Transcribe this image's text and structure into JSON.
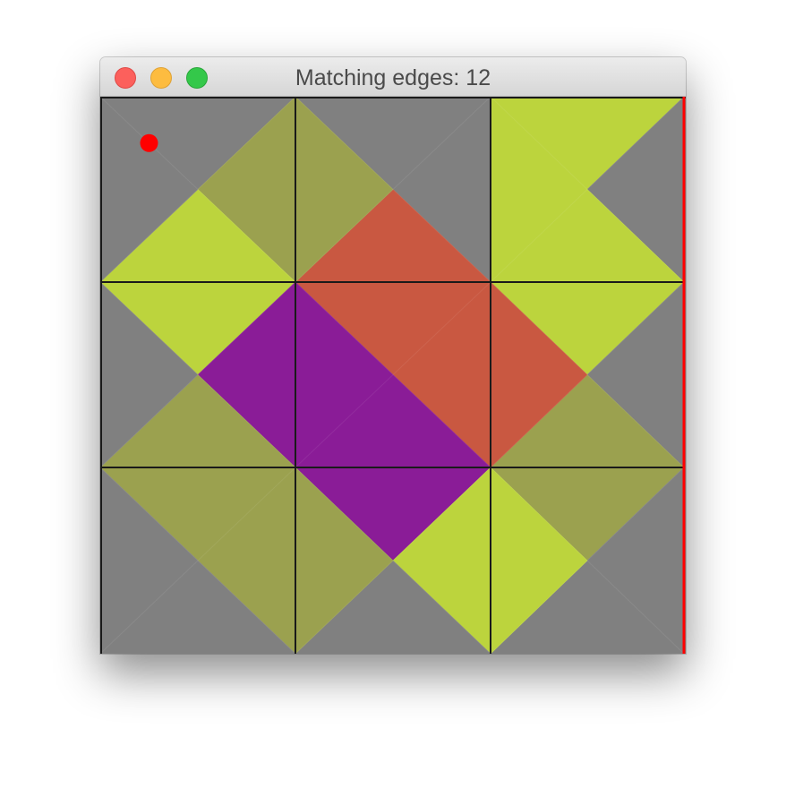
{
  "window": {
    "title": "Matching edges: 12"
  },
  "colors": {
    "gray": "#808080",
    "olive": "#9ba14f",
    "lime": "#bcd43d",
    "red": "#c95841",
    "purple": "#8a1c97",
    "grid_line": "#1a1a1a",
    "marker": "#ff0000"
  },
  "board": {
    "rows": 3,
    "cols": 3,
    "selected_tile": {
      "row": 0,
      "col": 0
    },
    "tiles": [
      [
        {
          "top": "gray",
          "right": "olive",
          "bottom": "lime",
          "left": "gray"
        },
        {
          "top": "gray",
          "right": "gray",
          "bottom": "red",
          "left": "olive"
        },
        {
          "top": "lime",
          "right": "gray",
          "bottom": "lime",
          "left": "lime"
        }
      ],
      [
        {
          "top": "lime",
          "right": "purple",
          "bottom": "olive",
          "left": "gray"
        },
        {
          "top": "red",
          "right": "red",
          "bottom": "purple",
          "left": "purple"
        },
        {
          "top": "lime",
          "right": "gray",
          "bottom": "olive",
          "left": "red"
        }
      ],
      [
        {
          "top": "olive",
          "right": "olive",
          "bottom": "gray",
          "left": "gray"
        },
        {
          "top": "purple",
          "right": "lime",
          "bottom": "gray",
          "left": "olive"
        },
        {
          "top": "olive",
          "right": "gray",
          "bottom": "gray",
          "left": "lime"
        }
      ]
    ]
  }
}
